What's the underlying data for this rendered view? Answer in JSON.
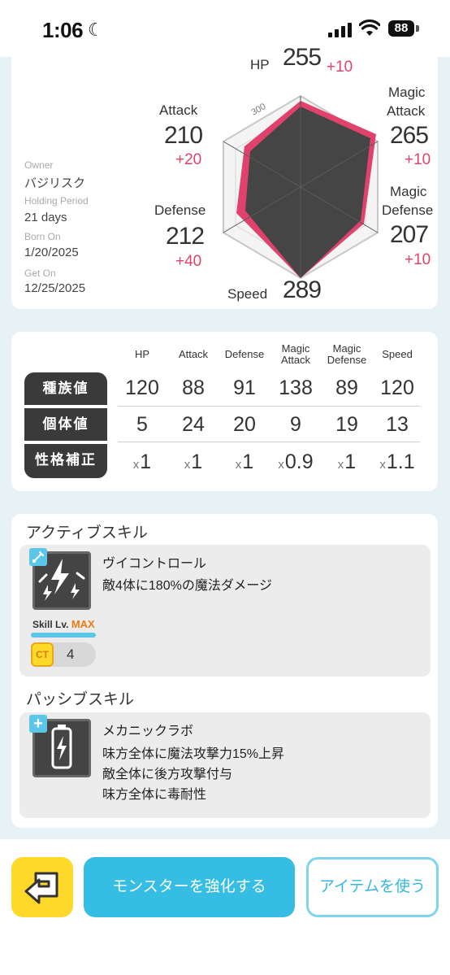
{
  "status_bar": {
    "time": "1:06",
    "battery": "88"
  },
  "owner_info": {
    "owner_label": "Owner",
    "owner_value": "バジリスク",
    "holding_label": "Holding Period",
    "holding_value": "21 days",
    "born_label": "Born On",
    "born_value": "1/20/2025",
    "get_label": "Get On",
    "get_value": "12/25/2025"
  },
  "radar": {
    "scale_label": "300",
    "hp": {
      "label": "HP",
      "value": "255",
      "bonus": "+10"
    },
    "attack": {
      "label": "Attack",
      "value": "210",
      "bonus": "+20"
    },
    "defense": {
      "label": "Defense",
      "value": "212",
      "bonus": "+40"
    },
    "speed": {
      "label": "Speed",
      "value": "289",
      "bonus": ""
    },
    "magic_attack": {
      "label_1": "Magic",
      "label_2": "Attack",
      "value": "265",
      "bonus": "+10"
    },
    "magic_defense": {
      "label_1": "Magic",
      "label_2": "Defense",
      "value": "207",
      "bonus": "+10"
    }
  },
  "stats_table": {
    "headers": [
      "HP",
      "Attack",
      "Defense",
      "Magic Attack",
      "Magic Defense",
      "Speed"
    ],
    "rows": [
      {
        "label": "種族値",
        "values": [
          "120",
          "88",
          "91",
          "138",
          "89",
          "120"
        ]
      },
      {
        "label": "個体値",
        "values": [
          "5",
          "24",
          "20",
          "9",
          "19",
          "13"
        ]
      },
      {
        "label": "性格補正",
        "prefix": "x",
        "values": [
          "1",
          "1",
          "1",
          "0.9",
          "1",
          "1.1"
        ]
      }
    ]
  },
  "active_skill": {
    "section_title": "アクティブスキル",
    "name": "ヴイコントロール",
    "description": "敵4体に180%の魔法ダメージ",
    "level_label": "Skill Lv.",
    "level_value": "MAX",
    "ct_label": "CT",
    "ct_value": "4"
  },
  "passive_skill": {
    "section_title": "パッシブスキル",
    "name": "メカニックラボ",
    "description_lines": [
      "味方全体に魔法攻撃力15%上昇",
      "敵全体に後方攻撃付与",
      "味方全体に毒耐性"
    ]
  },
  "buttons": {
    "enhance": "モンスターを強化する",
    "use_item": "アイテムを使う"
  },
  "colors": {
    "accent": "#36bde3",
    "bonus": "#e0426b",
    "back_button": "#ffd92a"
  }
}
